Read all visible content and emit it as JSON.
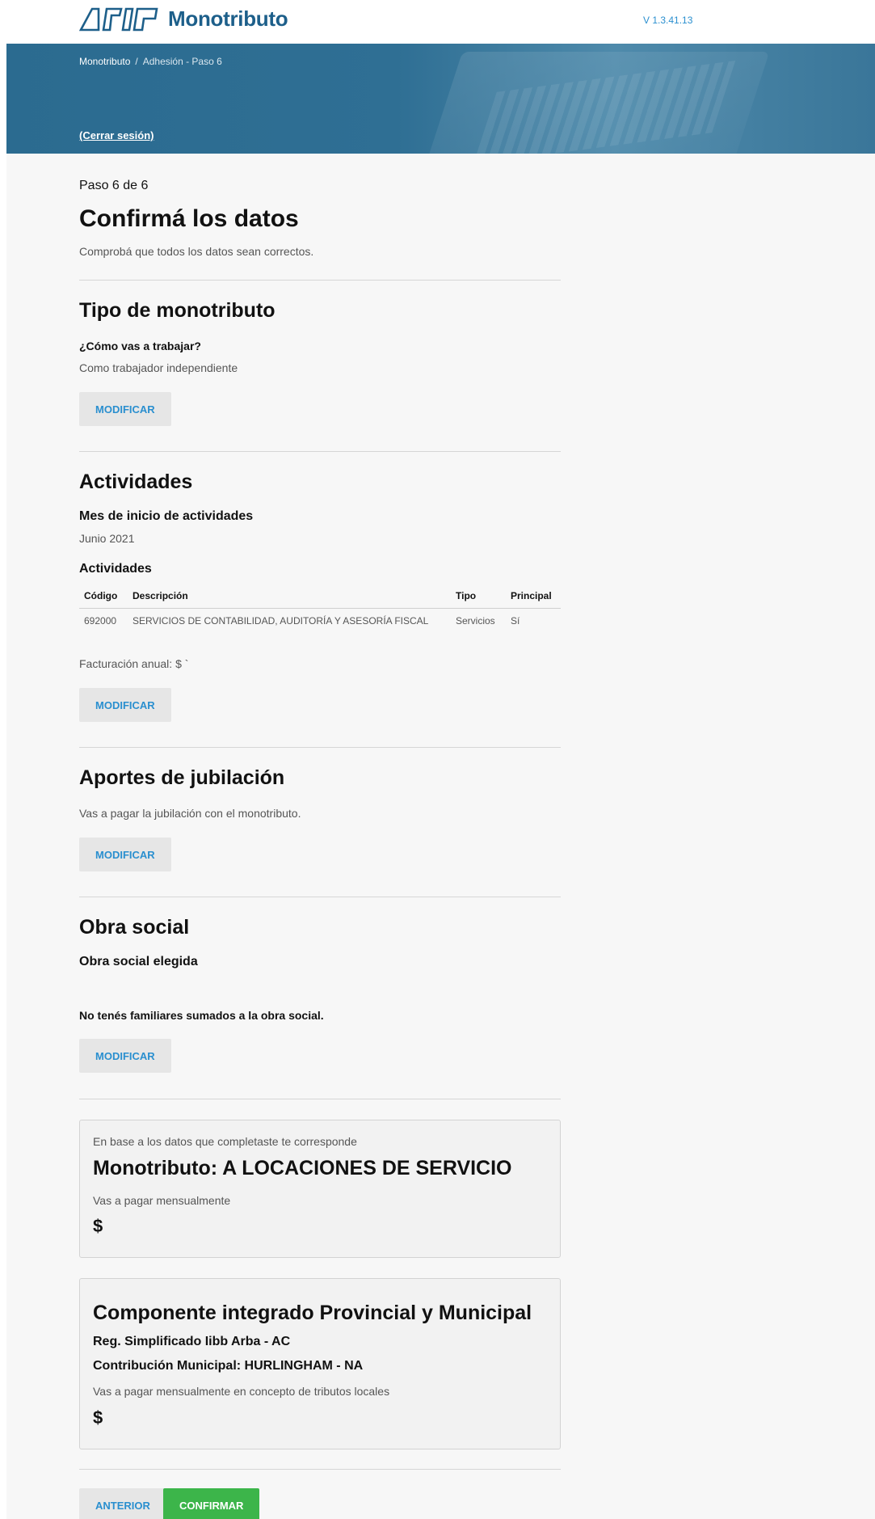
{
  "header": {
    "brand_name": "Monotributo",
    "version": "V 1.3.41.13"
  },
  "banner": {
    "breadcrumb_home": "Monotributo",
    "breadcrumb_sep": "/",
    "breadcrumb_current": "Adhesión - Paso 6",
    "logout": "(Cerrar sesión)"
  },
  "intro": {
    "step": "Paso 6 de 6",
    "title": "Confirmá los datos",
    "subtitle": "Comprobá que todos los datos sean correctos."
  },
  "tipo": {
    "title": "Tipo de monotributo",
    "question": "¿Cómo vas a trabajar?",
    "answer": "Como trabajador independiente",
    "button": "MODIFICAR"
  },
  "actividades": {
    "title": "Actividades",
    "start_label": "Mes de inicio de actividades",
    "start_value": "Junio 2021",
    "list_label": "Actividades",
    "columns": [
      "Código",
      "Descripción",
      "Tipo",
      "Principal"
    ],
    "rows": [
      [
        "692000",
        "SERVICIOS DE CONTABILIDAD, AUDITORÍA Y ASESORÍA FISCAL",
        "Servicios",
        "Sí"
      ]
    ],
    "billing": "Facturación anual: $ `",
    "button": "MODIFICAR"
  },
  "aportes": {
    "title": "Aportes de jubilación",
    "text": "Vas a pagar la jubilación con el monotributo.",
    "button": "MODIFICAR"
  },
  "obra_social": {
    "title": "Obra social",
    "chosen_label": "Obra social elegida",
    "family_text": "No tenés familiares sumados a la obra social.",
    "button": "MODIFICAR"
  },
  "categoria_card": {
    "intro": "En base a los datos que completaste te corresponde",
    "title": "Monotributo: A LOCACIONES DE SERVICIO",
    "pay_label": "Vas a pagar mensualmente",
    "amount": "$"
  },
  "componente_card": {
    "title": "Componente integrado Provincial y Municipal",
    "line1": "Reg. Simplificado Iibb Arba - AC",
    "line2": "Contribución Municipal: HURLINGHAM - NA",
    "pay_label": "Vas a pagar mensualmente en concepto de tributos locales",
    "amount": "$"
  },
  "footer_actions": {
    "back": "ANTERIOR",
    "confirm": "CONFIRMAR"
  },
  "colors": {
    "brand": "#1d5f8a",
    "link": "#2a8fcf",
    "confirm": "#3cb54a",
    "banner": "#2f6f94"
  }
}
